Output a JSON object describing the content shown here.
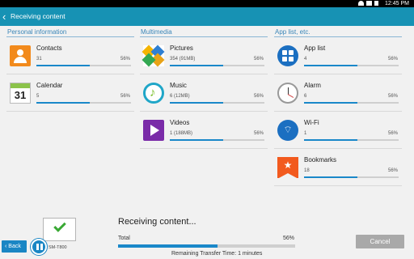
{
  "statusbar": {
    "time": "12:45 PM"
  },
  "appbar": {
    "title": "Receiving content",
    "back_glyph": "‹"
  },
  "columns": [
    {
      "heading": "Personal information",
      "items": [
        {
          "name": "Contacts",
          "count": "31",
          "percent": "56%",
          "progress": 0.56,
          "icon": "contacts-icon"
        },
        {
          "name": "Calendar",
          "count": "5",
          "percent": "56%",
          "progress": 0.56,
          "icon": "calendar-icon",
          "icon_text": "31"
        }
      ]
    },
    {
      "heading": "Multimedia",
      "items": [
        {
          "name": "Pictures",
          "count": "354 (91MB)",
          "percent": "56%",
          "progress": 0.56,
          "icon": "pictures-icon"
        },
        {
          "name": "Music",
          "count": "6 (12MB)",
          "percent": "56%",
          "progress": 0.56,
          "icon": "music-icon",
          "icon_text": "♪"
        },
        {
          "name": "Videos",
          "count": "1 (188MB)",
          "percent": "56%",
          "progress": 0.56,
          "icon": "videos-icon"
        }
      ]
    },
    {
      "heading": "App list, etc.",
      "items": [
        {
          "name": "App list",
          "count": "4",
          "percent": "56%",
          "progress": 0.56,
          "icon": "app-list-icon"
        },
        {
          "name": "Alarm",
          "count": "6",
          "percent": "56%",
          "progress": 0.56,
          "icon": "alarm-icon"
        },
        {
          "name": "Wi-Fi",
          "count": "1",
          "percent": "56%",
          "progress": 0.56,
          "icon": "wifi-icon",
          "icon_text": "⌔"
        },
        {
          "name": "Bookmarks",
          "count": "18",
          "percent": "56%",
          "progress": 0.56,
          "icon": "bookmarks-icon",
          "icon_text": "★"
        }
      ]
    }
  ],
  "bottom": {
    "back_label": "‹ Back",
    "device_label": "SM-T800",
    "receiving_title": "Receiving content...",
    "total_label": "Total",
    "total_percent": "56%",
    "total_progress": 0.56,
    "remaining_text": "Remaining Transfer Time: 1 minutes",
    "cancel_label": "Cancel"
  },
  "colors": {
    "accent": "#1792b4",
    "progress": "#1a88c9",
    "cancel": "#a9a9a9"
  }
}
